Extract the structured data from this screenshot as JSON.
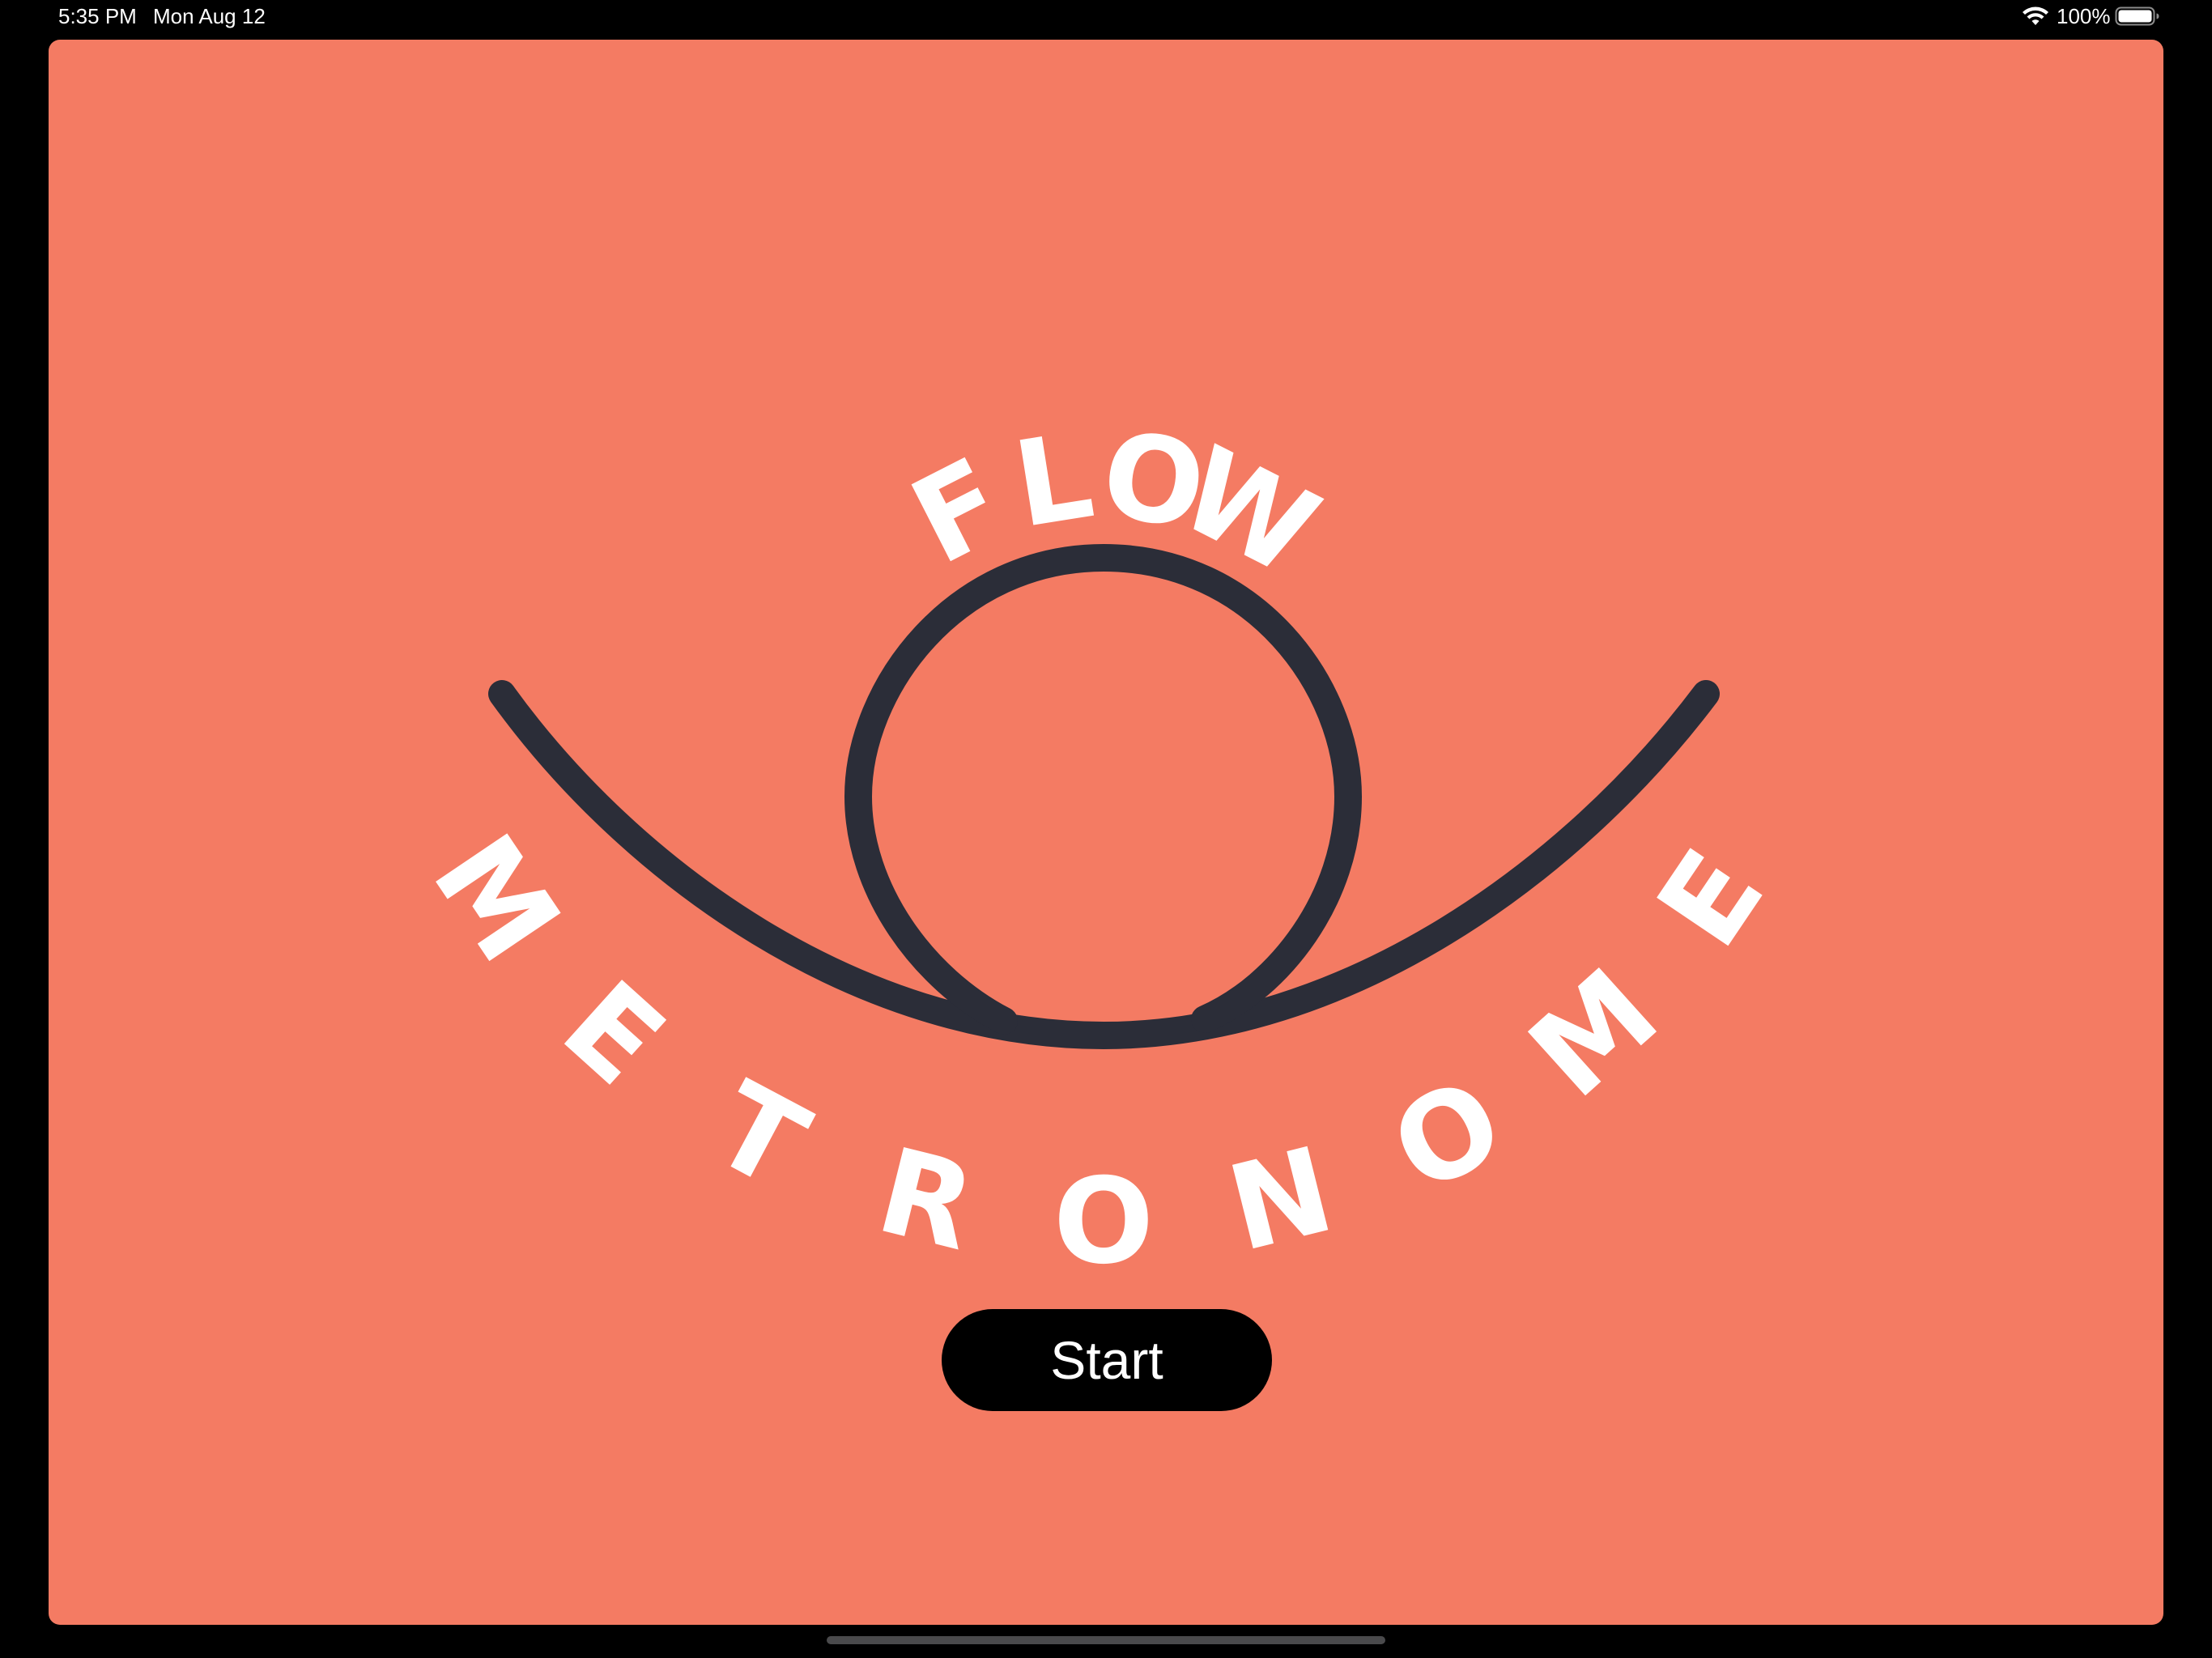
{
  "status_bar": {
    "time": "5:35 PM",
    "date": "Mon Aug 12",
    "battery": "100%",
    "wifi_icon": "wifi-icon",
    "battery_icon": "battery-icon"
  },
  "app": {
    "background_color": "#F47B63",
    "logo": {
      "top_word": "FLOW",
      "bottom_word": "METRONOME",
      "stroke_color": "#2B2D38",
      "text_color": "#FFFFFF",
      "icon": "flow-loop-icon"
    },
    "start_button": {
      "label": "Start",
      "background": "#000000",
      "text_color": "#FFFFFF"
    }
  }
}
